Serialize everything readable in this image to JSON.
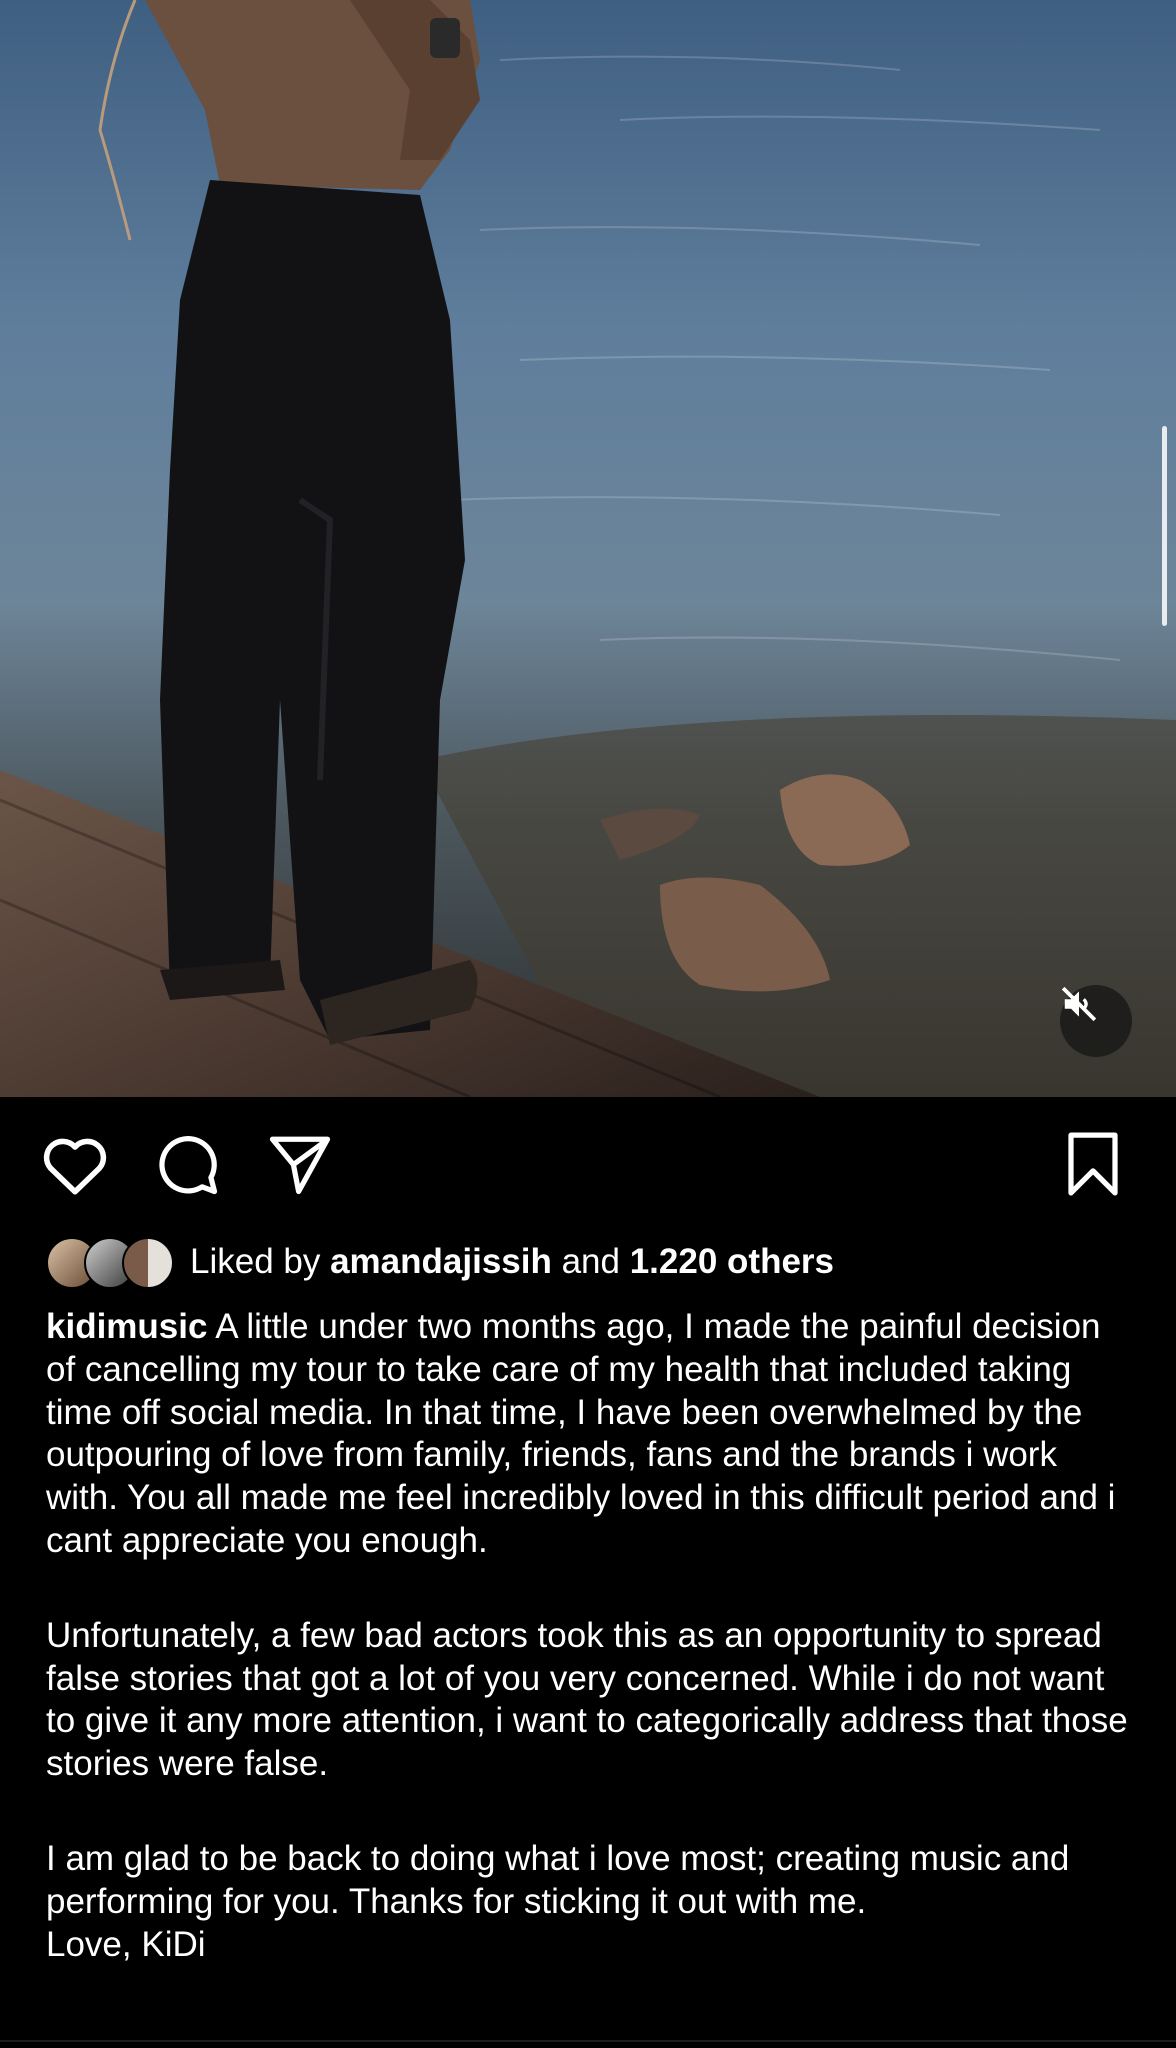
{
  "post": {
    "media": {
      "type": "video",
      "muted": true,
      "icons": {
        "mute": "speaker-muted-icon"
      }
    },
    "actions": {
      "like_icon": "heart-icon",
      "comment_icon": "comment-icon",
      "share_icon": "send-icon",
      "save_icon": "bookmark-icon"
    },
    "likes": {
      "prefix": "Liked by ",
      "first_liker": "amandajissih",
      "connector": " and ",
      "others": "1.220 others"
    },
    "caption": {
      "username": "kidimusic",
      "paragraph1": "A little under two months ago, I made the painful decision of cancelling my tour to take care of my health that included taking time off social media. In that time, I have been overwhelmed by the outpouring of love from family, friends, fans and the brands i work with. You all made me feel incredibly loved in this difficult period and i cant appreciate you enough.",
      "paragraph2": "Unfortunately, a few bad actors took this as an opportunity to spread false stories that got a lot of you very concerned. While i do not want to give it any more attention, i want to categorically address that those stories were false.",
      "paragraph3": "I am glad to be back to doing what i love most; creating music and performing for you. Thanks for sticking it out with me.\nLove, KiDi"
    },
    "colors": {
      "background": "#000000",
      "text": "#ffffff"
    }
  }
}
